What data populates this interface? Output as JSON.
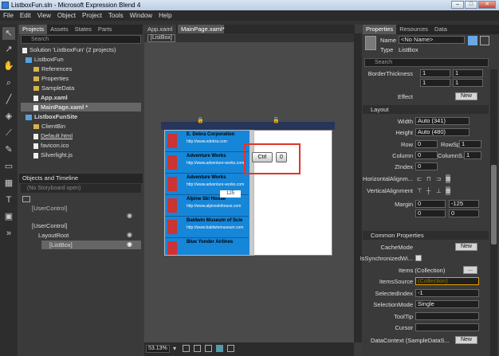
{
  "window": {
    "title": "ListboxFun.sln - Microsoft Expression Blend 4"
  },
  "menu": [
    "File",
    "Edit",
    "View",
    "Object",
    "Project",
    "Tools",
    "Window",
    "Help"
  ],
  "projects": {
    "tabs": [
      "Projects",
      "Assets",
      "States",
      "Parts"
    ],
    "search_placeholder": "Search",
    "tree": [
      "Solution 'ListboxFun' (2 projects)",
      "ListboxFun",
      "References",
      "Properties",
      "SampleData",
      "App.xaml",
      "MainPage.xaml *",
      "ListboxFunSite",
      "ClientBin",
      "Default.html",
      "favicon.ico",
      "Silverlight.js"
    ]
  },
  "objects": {
    "title": "Objects and Timeline",
    "storyboard": "(No Storyboard open)",
    "tree": [
      "[UserControl]",
      "[UserControl]",
      "LayoutRoot",
      "[ListBox]"
    ]
  },
  "document": {
    "tabs": [
      "App.xaml",
      "MainPage.xaml*"
    ],
    "breadcrumb": "[ListBox]",
    "zoom": "53.13%",
    "listbox_items": [
      {
        "title": "E. Debra Corporation",
        "sub": "http://www.edebra.com"
      },
      {
        "title": "Adventure Works",
        "sub": "http://www.adventure-works.com"
      },
      {
        "title": "Adventure Works",
        "sub": "http://www.adventure-works.com"
      },
      {
        "title": "Alpine Ski House",
        "sub": "http://www.alpineskihouse.com"
      },
      {
        "title": "Baldwin Museum of Scie",
        "sub": "http://www.baldwinmuseum.com"
      },
      {
        "title": "Blue Yonder Airlines",
        "sub": ""
      }
    ],
    "keys": [
      "Ctrl",
      "0"
    ],
    "tooltip_num": "125"
  },
  "properties": {
    "tabs": [
      "Properties",
      "Resources",
      "Data"
    ],
    "name_label": "Name",
    "name_value": "<No Name>",
    "type_label": "Type",
    "type_value": "ListBox",
    "search_placeholder": "Search",
    "border": {
      "label": "BorderThickness",
      "vals": [
        "1",
        "1",
        "1",
        "1"
      ]
    },
    "effect": {
      "label": "Effect",
      "btn": "New"
    },
    "layout": {
      "header": "Layout",
      "width": {
        "label": "Width",
        "value": "Auto (341)"
      },
      "height": {
        "label": "Height",
        "value": "Auto (480)"
      },
      "row": {
        "label": "Row",
        "value": "0"
      },
      "rowspan": {
        "label": "RowSpan",
        "value": "1"
      },
      "column": {
        "label": "Column",
        "value": "0"
      },
      "colspan": {
        "label": "ColumnS...",
        "value": "1"
      },
      "zindex": {
        "label": "ZIndex",
        "value": "0"
      },
      "halign": "HorizontalAlignm...",
      "valign": "VerticalAlignment",
      "margin": {
        "label": "Margin",
        "vals": [
          "0",
          "-125",
          "0",
          "0"
        ]
      }
    },
    "common": {
      "header": "Common Properties",
      "cachemode": {
        "label": "CacheMode",
        "btn": "New"
      },
      "sync": {
        "label": "IsSynchronizedWi..."
      },
      "items": {
        "label": "Items (Collection)",
        "btn": "..."
      },
      "itemssource": {
        "label": "ItemsSource",
        "value": "(Collection)"
      },
      "selectedindex": {
        "label": "SelectedIndex",
        "value": "-1"
      },
      "selectionmode": {
        "label": "SelectionMode",
        "value": "Single"
      },
      "tooltip": {
        "label": "ToolTip"
      },
      "cursor": {
        "label": "Cursor"
      },
      "datacontext": {
        "label": "DataContext (SampleDataS...",
        "btn": "New"
      }
    }
  },
  "colors": {
    "accent": "#1686d9",
    "panel": "#3a3a3a",
    "highlight_box": "#e0352b"
  }
}
